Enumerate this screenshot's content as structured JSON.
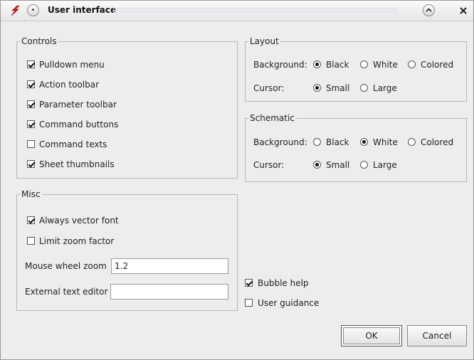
{
  "window": {
    "title": "User interface"
  },
  "controls": {
    "title": "Controls",
    "items": [
      {
        "label": "Pulldown menu",
        "checked": true
      },
      {
        "label": "Action toolbar",
        "checked": true
      },
      {
        "label": "Parameter toolbar",
        "checked": true
      },
      {
        "label": "Command buttons",
        "checked": true
      },
      {
        "label": "Command texts",
        "checked": false
      },
      {
        "label": "Sheet thumbnails",
        "checked": true
      }
    ]
  },
  "misc": {
    "title": "Misc",
    "always_vector_font": {
      "label": "Always vector font",
      "checked": true
    },
    "limit_zoom_factor": {
      "label": "Limit zoom factor",
      "checked": false
    },
    "mouse_wheel_zoom": {
      "label": "Mouse wheel zoom",
      "value": "1.2"
    },
    "external_text_editor": {
      "label": "External text editor",
      "value": ""
    }
  },
  "layout": {
    "title": "Layout",
    "background_label": "Background:",
    "cursor_label": "Cursor:",
    "background_options": [
      "Black",
      "White",
      "Colored"
    ],
    "background_selected": "Black",
    "cursor_options": [
      "Small",
      "Large"
    ],
    "cursor_selected": "Small"
  },
  "schematic": {
    "title": "Schematic",
    "background_label": "Background:",
    "cursor_label": "Cursor:",
    "background_options": [
      "Black",
      "White",
      "Colored"
    ],
    "background_selected": "White",
    "cursor_options": [
      "Small",
      "Large"
    ],
    "cursor_selected": "Small"
  },
  "bubble_help": {
    "label": "Bubble help",
    "checked": true
  },
  "user_guidance": {
    "label": "User guidance",
    "checked": false
  },
  "buttons": {
    "ok": "OK",
    "cancel": "Cancel"
  },
  "colors": {
    "app_icon": "#d62020",
    "dialog_bg": "#ededed"
  }
}
